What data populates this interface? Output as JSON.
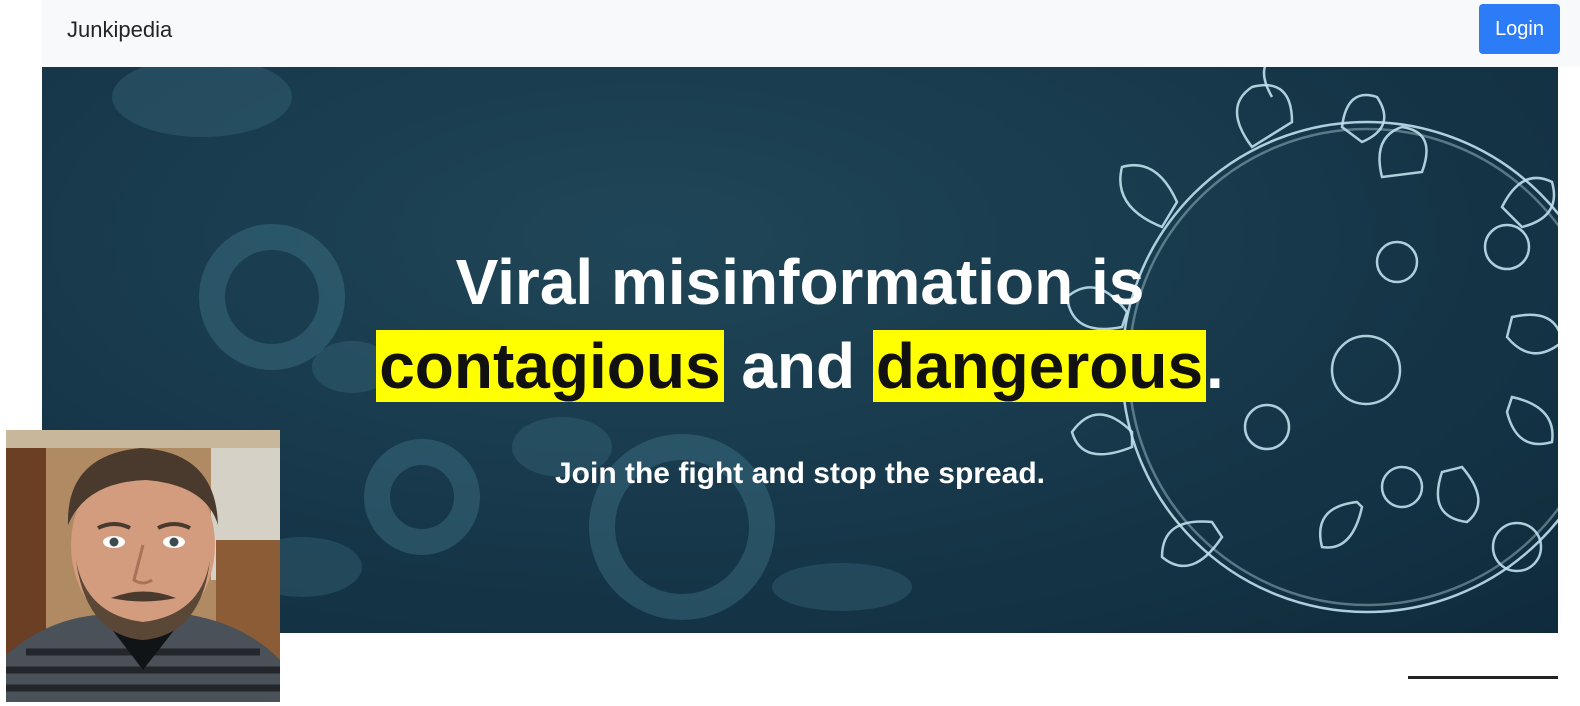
{
  "navbar": {
    "brand": "Junkipedia",
    "login_label": "Login"
  },
  "hero": {
    "headline_line1": "Viral misinformation is",
    "headline_word1": "contagious",
    "headline_and": "and",
    "headline_word2": "dangerous",
    "headline_period": ".",
    "subline": "Join the fight and stop the spread.",
    "highlight_color": "#ffff00",
    "background_color": "#163749",
    "background_image": "virus-illustration"
  },
  "overlay": {
    "avatar_image": "webcam-portrait"
  }
}
